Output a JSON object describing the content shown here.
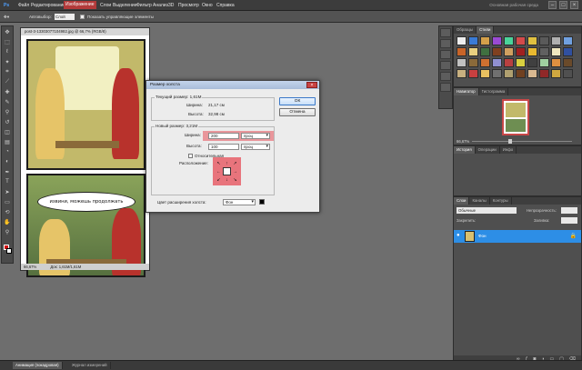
{
  "menu": {
    "items": [
      {
        "label": "Файл"
      },
      {
        "label": "Редактирование"
      },
      {
        "label": "Изображение"
      },
      {
        "label": "Слои"
      },
      {
        "label": "Выделение"
      },
      {
        "label": "Фильтр"
      },
      {
        "label": "Анализ"
      },
      {
        "label": "3D"
      },
      {
        "label": "Просмотр"
      },
      {
        "label": "Окно"
      },
      {
        "label": "Справка"
      }
    ],
    "active_index": 2,
    "workspace_label": "Основная рабочая среда",
    "window_controls": [
      "–",
      "□",
      "×"
    ]
  },
  "options": {
    "autoselect_label": "Автовыбор:",
    "autoselect_value": "Слой",
    "show_controls_label": "Показать управляющие элементы"
  },
  "document": {
    "title": "post-3-13303077104982.jpg @ 66,7% (RGB/8)",
    "zoom": "66,67%",
    "doc_size": "Док: 1,61M/1,61M",
    "speech": "извини, можешь продолжать"
  },
  "dialog": {
    "title": "Размер холста",
    "close": "×",
    "current_label": "Текущий размер: 1,61M",
    "cur_width_label": "Ширина:",
    "cur_width_value": "21,17 см",
    "cur_height_label": "Высота:",
    "cur_height_value": "32,98 см",
    "new_label": "Новый размер: 3,21M",
    "width_label": "Ширина:",
    "width_value": "200",
    "width_unit": "проц",
    "height_label": "Высота:",
    "height_value": "100",
    "height_unit": "проц",
    "relative_label": "Относительная",
    "anchor_label": "Расположение:",
    "anchor_arrows": [
      "↖",
      "↑",
      "↗",
      "←",
      "",
      "→",
      "↙",
      "↓",
      "↘"
    ],
    "ext_color_label": "Цвет расширения холста:",
    "ext_color_value": "Фон",
    "ok_label": "ОК",
    "cancel_label": "Отмена"
  },
  "right": {
    "styles_tabs": [
      "Образцы",
      "Стили"
    ],
    "nav_tabs": [
      "Навигатор",
      "Гистограмма"
    ],
    "nav_zoom": "66,67%",
    "hist_tabs": [
      "История",
      "Операции",
      "Инфо"
    ],
    "layers_tabs": [
      "Слои",
      "Каналы",
      "Контуры"
    ],
    "blend_mode": "Обычные",
    "opacity_label": "Непрозрачность:",
    "lock_label": "Закрепить:",
    "fill_label": "Заливка:",
    "layer_name": "Фон",
    "layer_lock_icon": "🔒"
  },
  "bottom": {
    "tabs": [
      "Анимация (покадровая)",
      "Журнал измерений"
    ]
  },
  "colors": {
    "foreground": "#d01010",
    "background": "#ffffff",
    "highlight": "#e8505a",
    "selected_layer": "#2d8ee6"
  }
}
